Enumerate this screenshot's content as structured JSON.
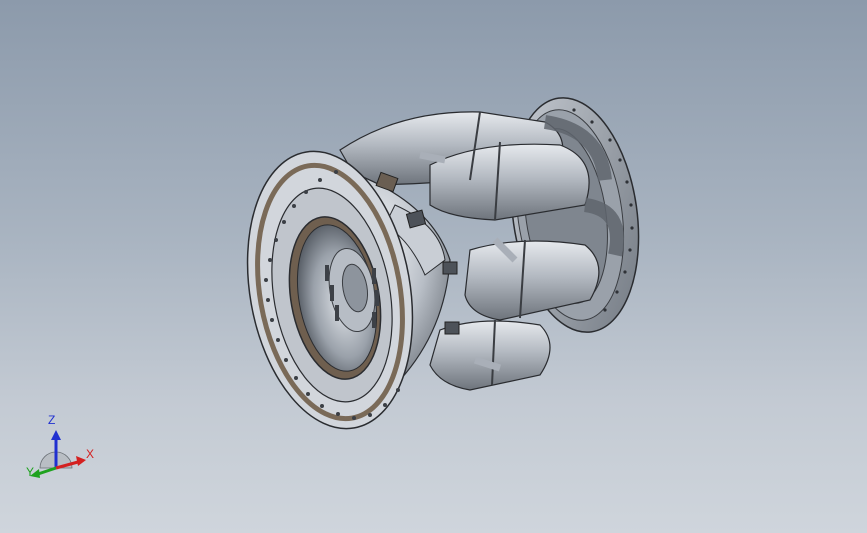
{
  "viewport": {
    "background_top": "#8c9aab",
    "background_bottom": "#cfd5dc"
  },
  "model": {
    "name_icon": "gas-turbine-assembly-3d-model",
    "shade_colors": {
      "metal_light": "#d8dce2",
      "metal_mid": "#a9afb8",
      "metal_dark": "#5f656d",
      "flange_bronze": "#7a6a58",
      "edge": "#2a2c30"
    }
  },
  "triad": {
    "x_label": "X",
    "y_label": "Y",
    "z_label": "Z",
    "x_color": "#d42020",
    "y_color": "#1fa21f",
    "z_color": "#2030d0"
  }
}
